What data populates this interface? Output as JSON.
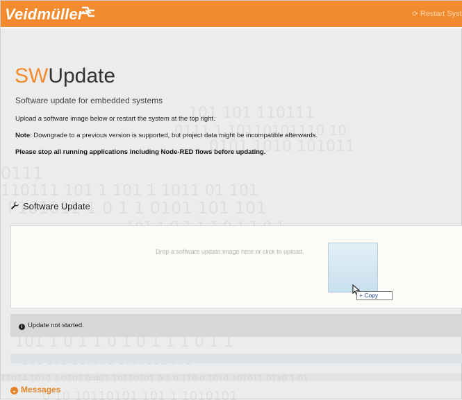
{
  "header": {
    "brand": "Veidmüller",
    "restart_label": "Restart System",
    "restart_icon": "refresh-icon",
    "accent_color": "#f28a2e"
  },
  "page": {
    "title_prefix": "SW",
    "title_rest": "Update",
    "subtitle": "Software update for embedded systems",
    "instruction": "Upload a software image below or restart the system at the top right.",
    "note_label": "Note",
    "note_text": ": Downgrade to a previous version is supported, but project data might be incompatible afterwards.",
    "warning": "Please stop all running applications including Node-RED flows before updating."
  },
  "software_update": {
    "heading": "Software Update",
    "heading_icon": "wrench-icon",
    "dropzone_hint": "Drop a software update image here or click to upload.",
    "drag_tooltip": "+ Copy",
    "status_icon": "info-icon",
    "status_text": "Update not started.",
    "progress": 0
  },
  "messages": {
    "heading": "Messages",
    "icon": "chevron-down-icon"
  }
}
